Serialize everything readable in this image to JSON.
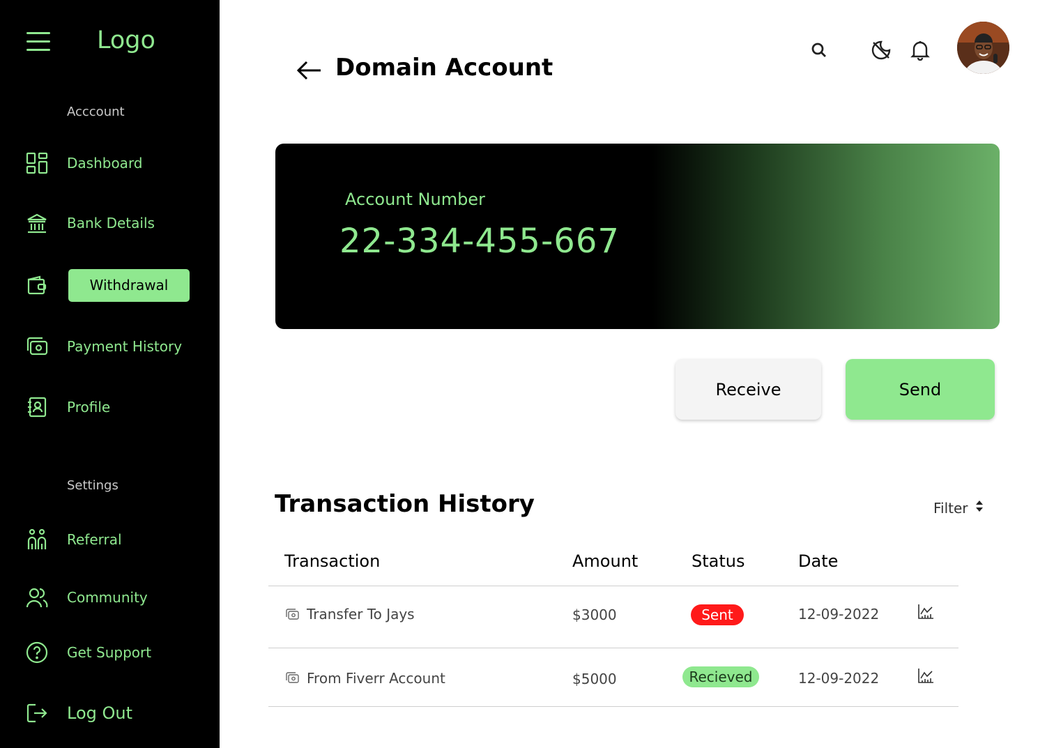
{
  "sidebar": {
    "logo": "Logo",
    "account_section": "Acccount",
    "settings_section": "Settings",
    "items": [
      {
        "label": "Dashboard",
        "icon": "dashboard-icon"
      },
      {
        "label": "Bank Details",
        "icon": "bank-icon"
      },
      {
        "label": "Withdrawal",
        "icon": "wallet-icon",
        "active": true
      },
      {
        "label": "Payment History",
        "icon": "money-icon"
      },
      {
        "label": "Profile",
        "icon": "contact-book-icon"
      }
    ],
    "settings_items": [
      {
        "label": "Referral",
        "icon": "people-icon"
      },
      {
        "label": "Community",
        "icon": "users-icon"
      },
      {
        "label": "Get Support",
        "icon": "help-icon"
      },
      {
        "label": "Log Out",
        "icon": "logout-icon"
      }
    ]
  },
  "header": {
    "title": "Domain Account"
  },
  "account_card": {
    "label": "Account Number",
    "number": "22-334-455-667"
  },
  "actions": {
    "receive": "Receive",
    "send": "Send"
  },
  "transactions": {
    "title": "Transaction History",
    "filter": "Filter",
    "columns": [
      "Transaction",
      "Amount",
      "Status",
      "Date"
    ],
    "rows": [
      {
        "name": "Transfer To Jays",
        "amount": "$3000",
        "status": "Sent",
        "date": "12-09-2022"
      },
      {
        "name": "From Fiverr Account",
        "amount": "$5000",
        "status": "Recieved",
        "date": "12-09-2022"
      }
    ]
  },
  "colors": {
    "accent": "#8fe88f",
    "sidebar_bg": "#000000",
    "sent": "#ff1a1a",
    "received": "#8fe88f"
  }
}
